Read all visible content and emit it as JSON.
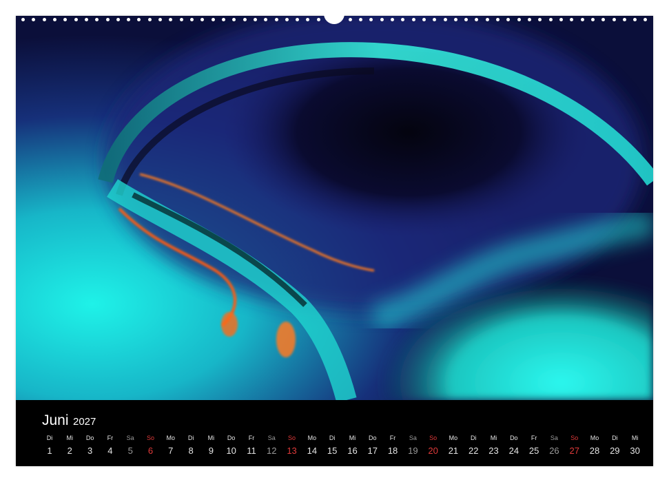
{
  "calendar": {
    "month": "Juni",
    "year": "2027",
    "days": [
      {
        "wd": "Di",
        "num": "1"
      },
      {
        "wd": "Mi",
        "num": "2"
      },
      {
        "wd": "Do",
        "num": "3"
      },
      {
        "wd": "Fr",
        "num": "4"
      },
      {
        "wd": "Sa",
        "num": "5"
      },
      {
        "wd": "So",
        "num": "6"
      },
      {
        "wd": "Mo",
        "num": "7"
      },
      {
        "wd": "Di",
        "num": "8"
      },
      {
        "wd": "Mi",
        "num": "9"
      },
      {
        "wd": "Do",
        "num": "10"
      },
      {
        "wd": "Fr",
        "num": "11"
      },
      {
        "wd": "Sa",
        "num": "12"
      },
      {
        "wd": "So",
        "num": "13"
      },
      {
        "wd": "Mo",
        "num": "14"
      },
      {
        "wd": "Di",
        "num": "15"
      },
      {
        "wd": "Mi",
        "num": "16"
      },
      {
        "wd": "Do",
        "num": "17"
      },
      {
        "wd": "Fr",
        "num": "18"
      },
      {
        "wd": "Sa",
        "num": "19"
      },
      {
        "wd": "So",
        "num": "20"
      },
      {
        "wd": "Mo",
        "num": "21"
      },
      {
        "wd": "Di",
        "num": "22"
      },
      {
        "wd": "Mi",
        "num": "23"
      },
      {
        "wd": "Do",
        "num": "24"
      },
      {
        "wd": "Fr",
        "num": "25"
      },
      {
        "wd": "Sa",
        "num": "26"
      },
      {
        "wd": "So",
        "num": "27"
      },
      {
        "wd": "Mo",
        "num": "28"
      },
      {
        "wd": "Di",
        "num": "29"
      },
      {
        "wd": "Mi",
        "num": "30"
      }
    ]
  },
  "colors": {
    "sunday": "#e03a3a",
    "saturday": "#9a9a9a",
    "weekday": "#e6e6e6",
    "background": "#000000"
  }
}
